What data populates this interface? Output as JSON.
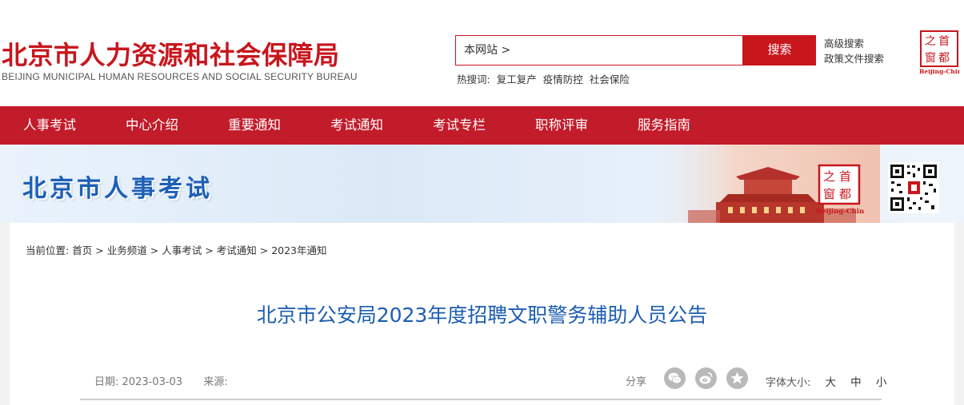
{
  "header": {
    "logo_cn": "北京市人力资源和社会保障局",
    "logo_en": "BEIJING MUNICIPAL HUMAN RESOURCES AND SOCIAL SECURITY BUREAU",
    "search_scope": "本网站 >",
    "search_button": "搜索",
    "hot_label": "热搜词:",
    "hot_terms": [
      "复工复产",
      "疫情防控",
      "社会保险"
    ],
    "advanced_search": "高级搜索",
    "policy_search": "政策文件搜索",
    "seal_chars": [
      "之",
      "首",
      "窗",
      "都"
    ],
    "seal_caption": "Beijing-China"
  },
  "nav": {
    "items": [
      "人事考试",
      "中心介绍",
      "重要通知",
      "考试通知",
      "考试专栏",
      "职称评审",
      "服务指南"
    ]
  },
  "banner": {
    "title": "北京市人事考试",
    "seal_chars": [
      "之",
      "首",
      "窗",
      "都"
    ],
    "seal_caption": "Beijing-China"
  },
  "breadcrumb": {
    "label": "当前位置:",
    "items": [
      "首页",
      "业务频道",
      "人事考试",
      "考试通知",
      "2023年通知"
    ]
  },
  "article": {
    "title": "北京市公安局2023年度招聘文职警务辅助人员公告",
    "date_label": "日期:",
    "date": "2023-03-03",
    "source_label": "来源:",
    "source": "",
    "share_label": "分享",
    "share_icons": [
      "wechat-icon",
      "weibo-icon",
      "favorite-star-icon"
    ],
    "font_size_label": "字体大小:",
    "font_sizes": [
      "大",
      "中",
      "小"
    ]
  },
  "colors": {
    "brand_red": "#c8161d",
    "nav_red": "#c21b29",
    "title_blue": "#1c5db1",
    "banner_blue": "#1d5fb7"
  }
}
